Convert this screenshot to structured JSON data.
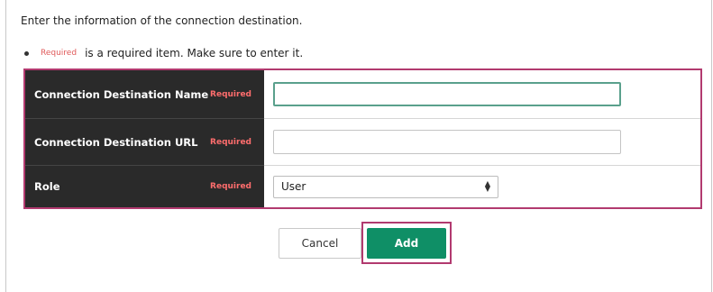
{
  "intro_text": "Enter the information of the connection destination.",
  "note": {
    "required_tag": "Required",
    "text": "is a required item. Make sure to enter it."
  },
  "form": {
    "rows": [
      {
        "label": "Connection Destination Name",
        "required": "Required",
        "value": "",
        "focused": true
      },
      {
        "label": "Connection Destination URL",
        "required": "Required",
        "value": ""
      },
      {
        "label": "Role",
        "required": "Required",
        "selected": "User"
      }
    ]
  },
  "buttons": {
    "cancel": "Cancel",
    "add": "Add"
  },
  "colors": {
    "highlight": "#b23a6f",
    "label_bg": "#2a2a2a",
    "required": "#ff6d6d",
    "primary": "#0f8f66"
  }
}
